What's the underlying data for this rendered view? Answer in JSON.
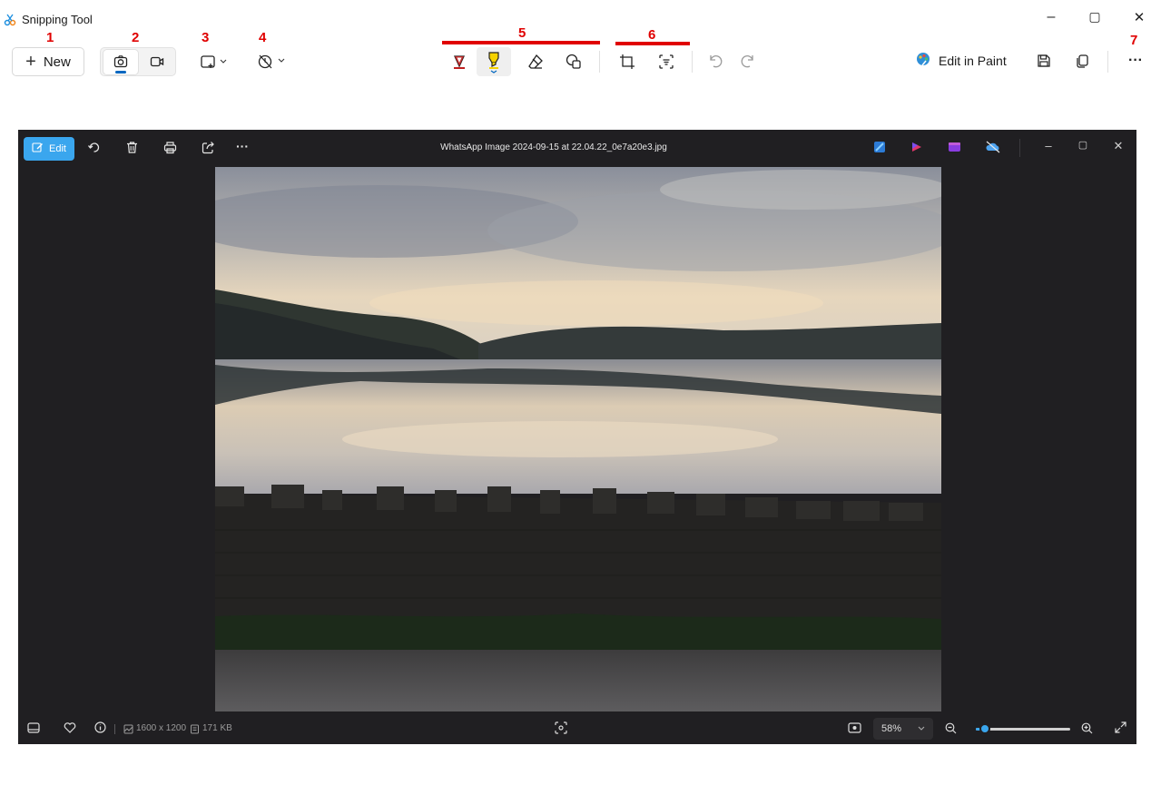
{
  "app": {
    "title": "Snipping Tool",
    "window_controls": {
      "minimize": "–",
      "maximize": "▢",
      "close": "✕"
    }
  },
  "annotations": [
    "1",
    "2",
    "3",
    "4",
    "5",
    "6",
    "7"
  ],
  "toolbar": {
    "new_label": "New",
    "edit_in_paint_label": "Edit in Paint",
    "more_label": "···",
    "icons": [
      "camera-icon",
      "video-icon",
      "snip-shape-icon",
      "timer-icon",
      "pen-icon",
      "highlighter-icon",
      "eraser-icon",
      "shapes-icon",
      "crop-icon",
      "text-actions-icon",
      "undo-icon",
      "redo-icon",
      "paint-icon",
      "save-icon",
      "copy-icon"
    ],
    "colors": {
      "accent": "#0067c0",
      "annotation": "#e00000",
      "highlighter": "#f5d200",
      "pen": "#c02020"
    }
  },
  "viewer": {
    "edit_label": "Edit",
    "filename": "WhatsApp Image 2024-09-15 at 22.04.22_0e7a20e3.jpg",
    "more_label": "···",
    "window_controls": {
      "minimize": "–",
      "maximize": "▢",
      "close": "✕"
    },
    "dimensions": "1600 x 1200",
    "file_size": "171 KB",
    "zoom_value": "58%",
    "zoom_slider_fraction": 0.1,
    "colors": {
      "background": "#201f22",
      "edit_button": "#3aa6ee"
    }
  }
}
